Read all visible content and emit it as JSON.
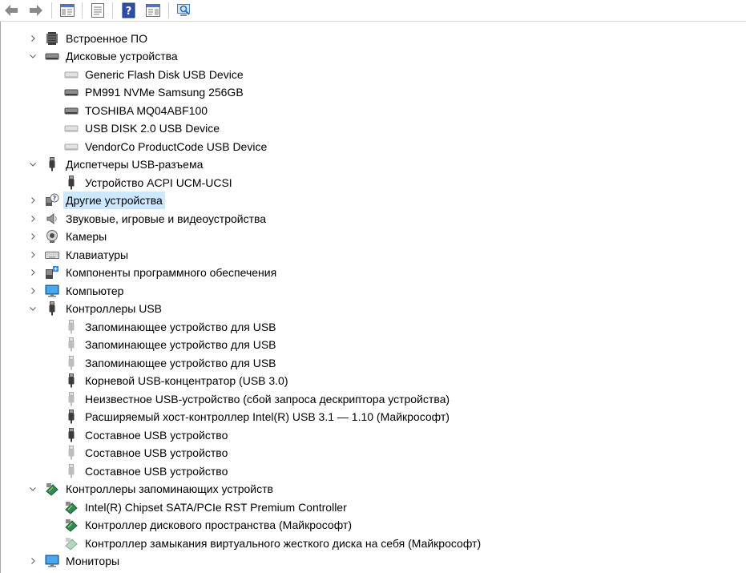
{
  "toolbar": {
    "buttons": [
      {
        "name": "back-arrow-icon"
      },
      {
        "name": "forward-arrow-icon"
      },
      {
        "name": "show-hide-console-tree-icon"
      },
      {
        "name": "properties-icon"
      },
      {
        "name": "help-icon"
      },
      {
        "name": "action-pane-icon"
      },
      {
        "name": "scan-hardware-icon"
      }
    ]
  },
  "tree": [
    {
      "level": 0,
      "expand": "collapsed",
      "icon": "firmware-icon",
      "label": "Встроенное ПО"
    },
    {
      "level": 0,
      "expand": "expanded",
      "icon": "disk-drive-icon",
      "label": "Дисковые устройства"
    },
    {
      "level": 1,
      "expand": "none",
      "icon": "disk-drive-light-icon",
      "label": "Generic Flash Disk USB Device"
    },
    {
      "level": 1,
      "expand": "none",
      "icon": "disk-drive-icon",
      "label": "PM991 NVMe Samsung 256GB"
    },
    {
      "level": 1,
      "expand": "none",
      "icon": "disk-drive-icon",
      "label": "TOSHIBA MQ04ABF100"
    },
    {
      "level": 1,
      "expand": "none",
      "icon": "disk-drive-light-icon",
      "label": "USB DISK 2.0 USB Device"
    },
    {
      "level": 1,
      "expand": "none",
      "icon": "disk-drive-light-icon",
      "label": "VendorCo ProductCode USB Device"
    },
    {
      "level": 0,
      "expand": "expanded",
      "icon": "usb-connector-icon",
      "label": "Диспетчеры USB-разъема"
    },
    {
      "level": 1,
      "expand": "none",
      "icon": "usb-connector-icon",
      "label": "Устройство ACPI UCM-UCSI"
    },
    {
      "level": 0,
      "expand": "collapsed",
      "icon": "unknown-device-icon",
      "label": "Другие устройства",
      "selected": true
    },
    {
      "level": 0,
      "expand": "collapsed",
      "icon": "speaker-icon",
      "label": "Звуковые, игровые и видеоустройства"
    },
    {
      "level": 0,
      "expand": "collapsed",
      "icon": "webcam-icon",
      "label": "Камеры"
    },
    {
      "level": 0,
      "expand": "collapsed",
      "icon": "keyboard-icon",
      "label": "Клавиатуры"
    },
    {
      "level": 0,
      "expand": "collapsed",
      "icon": "software-component-icon",
      "label": "Компоненты программного обеспечения"
    },
    {
      "level": 0,
      "expand": "collapsed",
      "icon": "monitor-icon",
      "label": "Компьютер"
    },
    {
      "level": 0,
      "expand": "expanded",
      "icon": "usb-connector-icon",
      "label": "Контроллеры USB"
    },
    {
      "level": 1,
      "expand": "none",
      "icon": "usb-light-icon",
      "label": "Запоминающее устройство для USB"
    },
    {
      "level": 1,
      "expand": "none",
      "icon": "usb-light-icon",
      "label": "Запоминающее устройство для USB"
    },
    {
      "level": 1,
      "expand": "none",
      "icon": "usb-light-icon",
      "label": "Запоминающее устройство для USB"
    },
    {
      "level": 1,
      "expand": "none",
      "icon": "usb-connector-icon",
      "label": "Корневой USB-концентратор (USB 3.0)"
    },
    {
      "level": 1,
      "expand": "none",
      "icon": "usb-light-icon",
      "label": "Неизвестное USB-устройство (сбой запроса дескриптора устройства)"
    },
    {
      "level": 1,
      "expand": "none",
      "icon": "usb-connector-icon",
      "label": "Расширяемый хост-контроллер Intel(R) USB 3.1 — 1.10 (Майкрософт)"
    },
    {
      "level": 1,
      "expand": "none",
      "icon": "usb-connector-icon",
      "label": "Составное USB устройство"
    },
    {
      "level": 1,
      "expand": "none",
      "icon": "usb-light-icon",
      "label": "Составное USB устройство"
    },
    {
      "level": 1,
      "expand": "none",
      "icon": "usb-light-icon",
      "label": "Составное USB устройство"
    },
    {
      "level": 0,
      "expand": "expanded",
      "icon": "storage-controller-icon",
      "label": "Контроллеры запоминающих устройств"
    },
    {
      "level": 1,
      "expand": "none",
      "icon": "storage-controller-icon",
      "label": "Intel(R) Chipset SATA/PCIe RST Premium Controller"
    },
    {
      "level": 1,
      "expand": "none",
      "icon": "storage-controller-icon",
      "label": "Контроллер дискового пространства (Майкрософт)"
    },
    {
      "level": 1,
      "expand": "none",
      "icon": "storage-controller-light-icon",
      "label": "Контроллер замыкания виртуального жесткого диска на себя (Майкрософт)"
    },
    {
      "level": 0,
      "expand": "collapsed",
      "icon": "monitor-icon",
      "label": "Мониторы"
    }
  ],
  "colors": {
    "selection": "#cce8ff",
    "chevron": "#606060"
  }
}
